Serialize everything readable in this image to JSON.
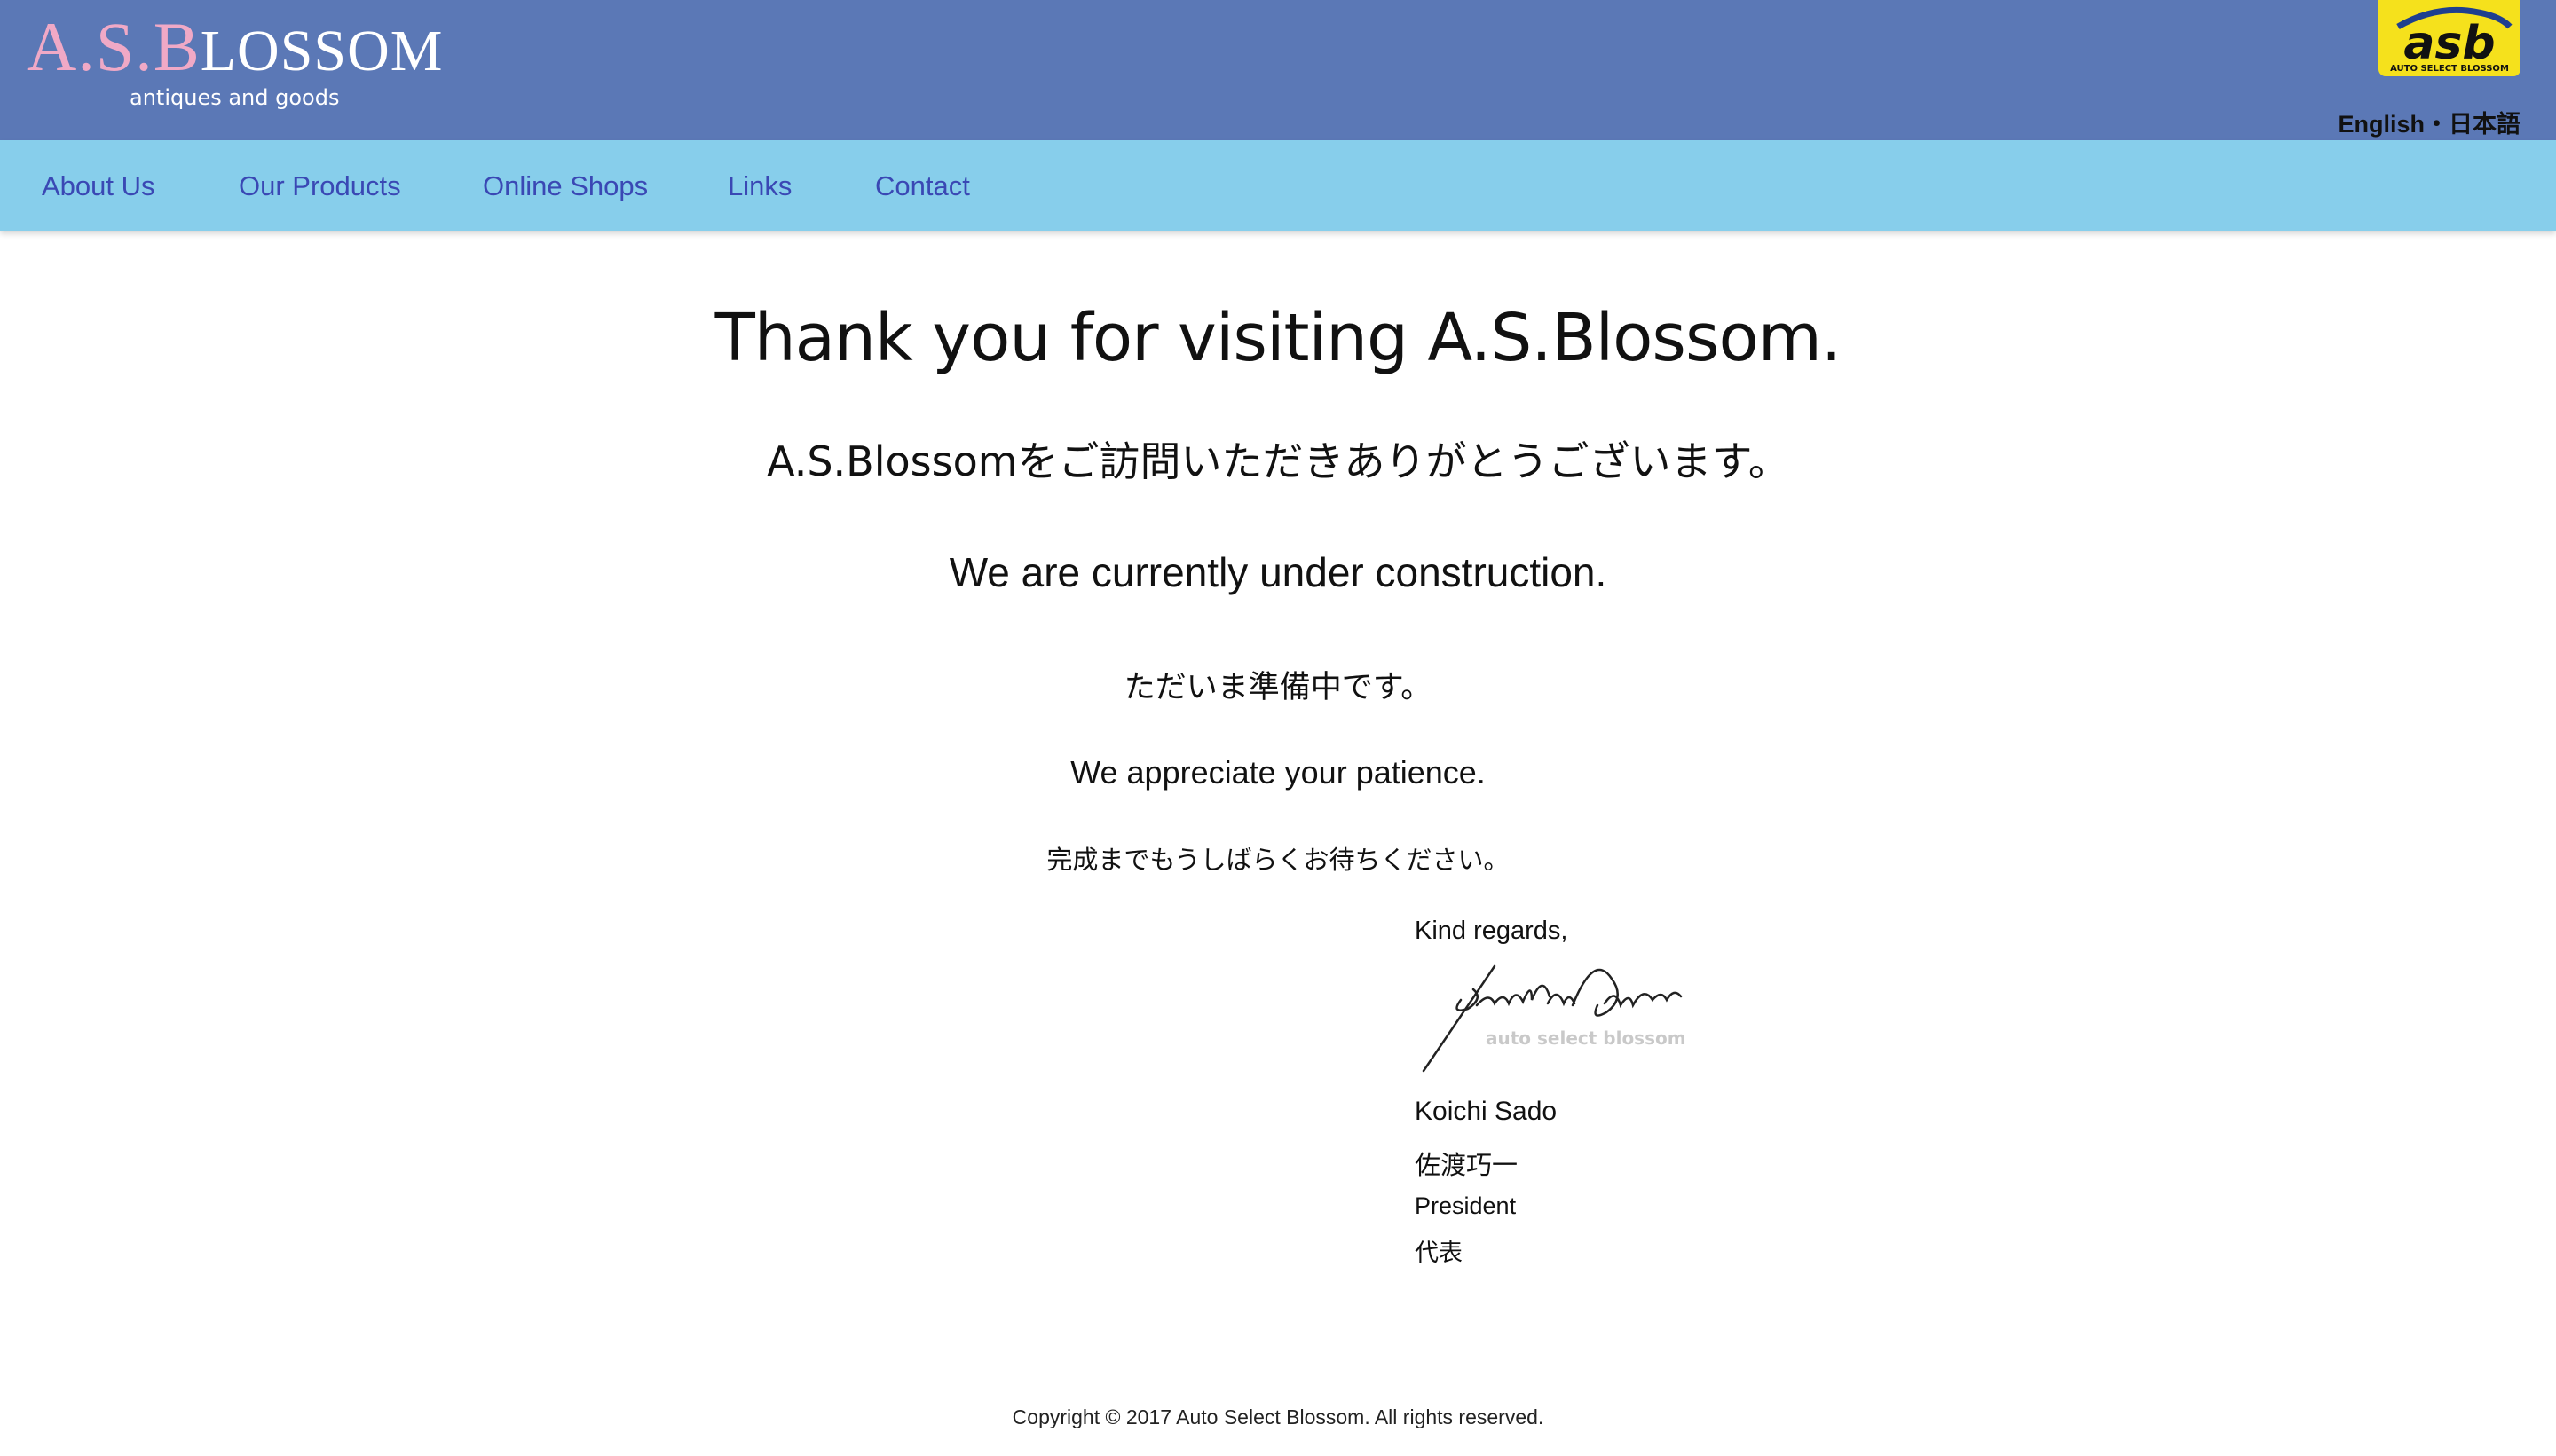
{
  "header": {
    "logo": {
      "pink_part": "A.S.B",
      "rest_part": "LOSSOM",
      "tagline": "antiques and goods"
    },
    "badge": {
      "text": "asb",
      "subtext": "AUTO SELECT BLOSSOM"
    },
    "language": {
      "english": "English",
      "separator": "・",
      "japanese": "日本語"
    }
  },
  "nav": {
    "items": [
      {
        "label": "About Us"
      },
      {
        "label": "Our Products"
      },
      {
        "label": "Online Shops"
      },
      {
        "label": "Links"
      },
      {
        "label": "Contact"
      }
    ]
  },
  "main": {
    "headline": "Thank you for visiting A.S.Blossom.",
    "headline_ja": "A.S.Blossomをご訪問いただきありがとうございます。",
    "construction": "We are currently under construction.",
    "construction_ja": "ただいま準備中です。",
    "patience": "We appreciate your patience.",
    "patience_ja": "完成までもうしばらくお待ちください。"
  },
  "signature": {
    "regards": "Kind regards,",
    "handwriting": "Koichi Sado",
    "watermark": "auto select blossom",
    "name": "Koichi Sado",
    "name_ja": "佐渡巧一",
    "title": "President",
    "title_ja": "代表"
  },
  "footer": {
    "copyright": "Copyright © 2017 Auto Select Blossom. All rights reserved."
  },
  "colors": {
    "header_bg": "#5b78b6",
    "nav_bg": "#87ceeb",
    "nav_link": "#3a48b4",
    "logo_pink": "#f0a9c6",
    "badge_yellow": "#f5e11c"
  }
}
